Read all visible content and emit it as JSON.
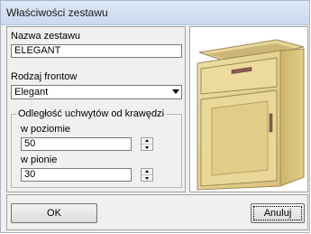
{
  "window": {
    "title": "Właściwości zestawu"
  },
  "form": {
    "set_name_label": "Nazwa zestawu",
    "set_name_value": "ELEGANT",
    "front_type_label": "Rodzaj frontow",
    "front_type_value": "Elegant",
    "handle_offset_group": "Odległość uchwytów od krawędzi",
    "horizontal_label": "w poziomie",
    "horizontal_value": "50",
    "vertical_label": "w pionie",
    "vertical_value": "30"
  },
  "buttons": {
    "ok": "OK",
    "cancel": "Anuluj"
  },
  "preview": {
    "wood_color": "#e6d28e",
    "dark_edge": "#8a7a50"
  }
}
